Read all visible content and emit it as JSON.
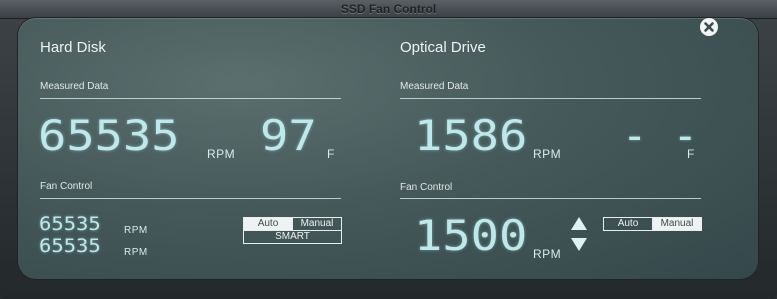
{
  "window": {
    "title": "SSD Fan Control"
  },
  "hard_disk": {
    "title": "Hard Disk",
    "measured_label": "Measured Data",
    "rpm_value": "65535",
    "rpm_unit": "RPM",
    "temp_value": "97",
    "temp_unit": "F",
    "fan_control_label": "Fan Control",
    "fan_rpm_1": "65535",
    "fan_rpm_2": "65535",
    "fan_unit": "RPM",
    "mode_auto": "Auto",
    "mode_manual": "Manual",
    "mode_smart": "SMART",
    "selected_mode": "Auto"
  },
  "optical_drive": {
    "title": "Optical Drive",
    "measured_label": "Measured Data",
    "rpm_value": "1586",
    "rpm_unit": "RPM",
    "temp_value": "- -",
    "temp_unit": "F",
    "fan_control_label": "Fan Control",
    "target_rpm": "1500",
    "target_unit": "RPM",
    "mode_auto": "Auto",
    "mode_manual": "Manual",
    "selected_mode": "Manual"
  },
  "colors": {
    "digit": "#bfe8ea",
    "panel": "#45595a"
  },
  "icons": {
    "close": "close-icon",
    "stepper": "up-down-arrows-icon"
  }
}
